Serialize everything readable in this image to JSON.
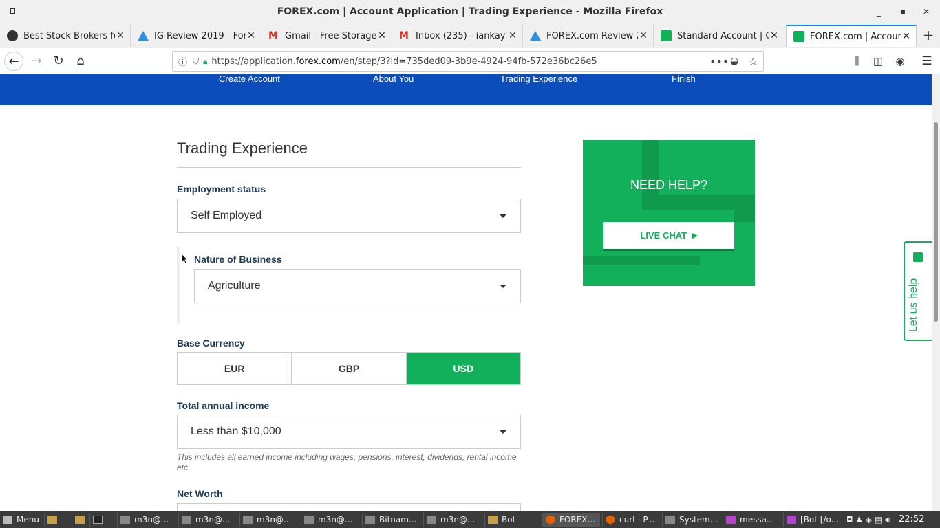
{
  "window": {
    "title": "FOREX.com | Account Application | Trading Experience - Mozilla Firefox"
  },
  "tabs": [
    {
      "label": "Best Stock Brokers fo",
      "icon": "investor-icon",
      "active": false
    },
    {
      "label": "IG Review 2019 - For",
      "icon": "triangle-icon",
      "active": false
    },
    {
      "label": "Gmail - Free Storage a",
      "icon": "gmail-icon",
      "active": false
    },
    {
      "label": "Inbox (235) - iankay7",
      "icon": "gmail-icon",
      "active": false
    },
    {
      "label": "FOREX.com Review 2(",
      "icon": "triangle-icon",
      "active": false
    },
    {
      "label": "Standard Account | C",
      "icon": "forex-icon",
      "active": false
    },
    {
      "label": "FOREX.com | Account",
      "icon": "forex-icon",
      "active": true
    }
  ],
  "navbar": {
    "url_prefix": "https://application.",
    "url_domain": "forex.com",
    "url_suffix": "/en/step/3?id=735ded09-3b9e-4924-94fb-572e36bc26e5"
  },
  "steps": [
    "Create Account",
    "About You",
    "Trading Experience",
    "Finish"
  ],
  "form": {
    "heading": "Trading Experience",
    "employment_label": "Employment status",
    "employment_value": "Self Employed",
    "business_label": "Nature of Business",
    "business_value": "Agriculture",
    "currency_label": "Base Currency",
    "currencies": [
      "EUR",
      "GBP",
      "USD"
    ],
    "currency_selected": "USD",
    "income_label": "Total annual income",
    "income_value": "Less than $10,000",
    "income_hint": "This includes all earned income including wages, pensions, interest, dividends, rental income etc.",
    "networth_label": "Net Worth"
  },
  "help": {
    "title": "NEED HELP?",
    "chat_label": "LIVE CHAT",
    "side_label": "Let us help"
  },
  "taskbar": {
    "menu_label": "Menu",
    "items": [
      "m3n@...",
      "m3n@...",
      "m3n@...",
      "m3n@...",
      "Bitnam...",
      "m3n@...",
      "Bot",
      "FOREX...",
      "curl - P...",
      "System...",
      "messa...",
      "[Bot [/o..."
    ],
    "clock": "22:52"
  },
  "colors": {
    "brand_blue": "#0b4dbb",
    "brand_green": "#12b05a"
  }
}
